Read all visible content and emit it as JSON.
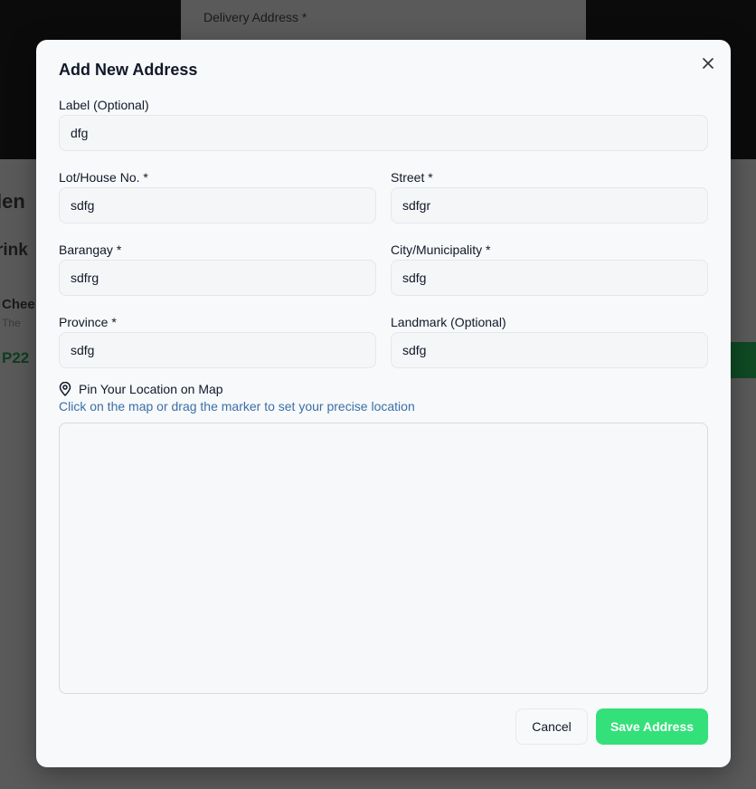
{
  "background": {
    "top_label": "Delivery Address *",
    "heading_fragment": "len",
    "subheading_fragment": "rink",
    "item_fragment": "Chee",
    "item_sub_fragment": "The",
    "price_fragment": "P22"
  },
  "modal": {
    "title": "Add New Address",
    "close_icon": "close-icon",
    "fields": {
      "label": {
        "label": "Label (Optional)",
        "value": "dfg"
      },
      "lot": {
        "label": "Lot/House No. *",
        "value": "sdfg"
      },
      "street": {
        "label": "Street *",
        "value": "sdfgr"
      },
      "barangay": {
        "label": "Barangay *",
        "value": "sdfrg"
      },
      "city": {
        "label": "City/Municipality *",
        "value": "sdfg"
      },
      "province": {
        "label": "Province *",
        "value": "sdfg"
      },
      "landmark": {
        "label": "Landmark (Optional)",
        "value": "sdfg"
      }
    },
    "map": {
      "icon": "map-pin-icon",
      "title": "Pin Your Location on Map",
      "hint": "Click on the map or drag the marker to set your precise location"
    },
    "buttons": {
      "cancel": "Cancel",
      "save": "Save Address"
    }
  },
  "colors": {
    "accent": "#34e07a",
    "hint_text": "#3b6fa5",
    "overlay": "#5a5a5a"
  }
}
